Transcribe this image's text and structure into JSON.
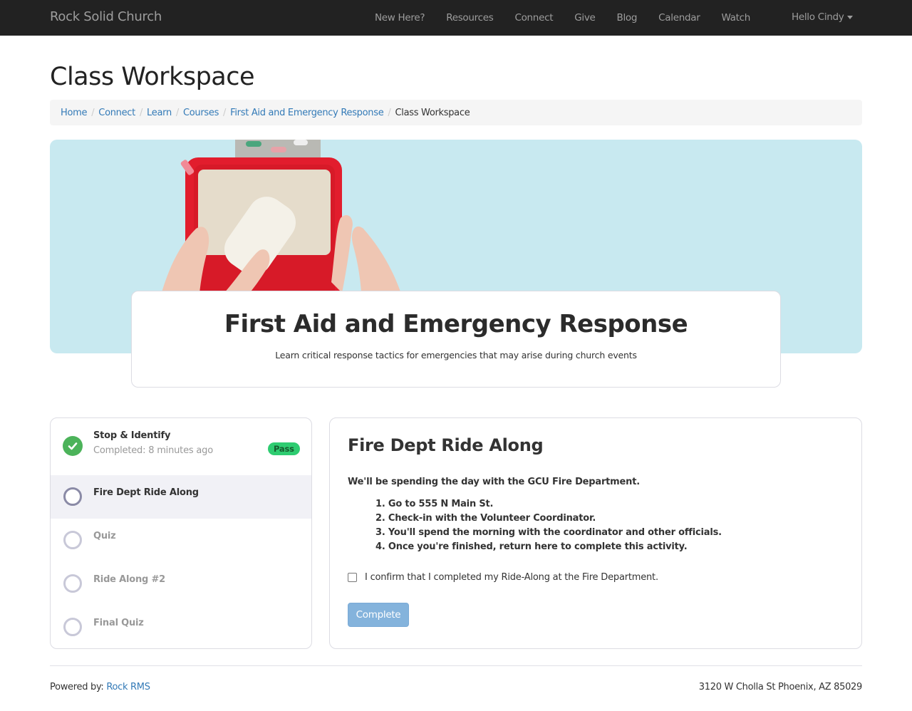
{
  "navbar": {
    "brand": "Rock Solid Church",
    "links": [
      "New Here?",
      "Resources",
      "Connect",
      "Give",
      "Blog",
      "Calendar",
      "Watch"
    ],
    "user_menu": "Hello Cindy"
  },
  "page": {
    "title": "Class Workspace"
  },
  "breadcrumb": {
    "items": [
      "Home",
      "Connect",
      "Learn",
      "Courses",
      "First Aid and Emergency Response"
    ],
    "active": "Class Workspace"
  },
  "course": {
    "title": "First Aid and Emergency Response",
    "description": "Learn critical response tactics for emergencies that may arise during church events",
    "hero_image": "first-aid-kit-photo"
  },
  "activities": [
    {
      "title": "Stop & Identify",
      "subtitle": "Completed: 8 minutes ago",
      "status": "completed",
      "badge": "Pass",
      "icon": "check-circle-icon"
    },
    {
      "title": "Fire Dept Ride Along",
      "status": "current",
      "icon": "circle-outline-icon"
    },
    {
      "title": "Quiz",
      "status": "locked",
      "icon": "circle-outline-icon"
    },
    {
      "title": "Ride Along #2",
      "status": "locked",
      "icon": "circle-outline-icon"
    },
    {
      "title": "Final Quiz",
      "status": "locked",
      "icon": "circle-outline-icon"
    }
  ],
  "activity_panel": {
    "title": "Fire Dept Ride Along",
    "intro": "We'll be spending the day with the GCU Fire Department.",
    "steps": [
      "1. Go to 555 N Main St.",
      "2. Check-in with the Volunteer Coordinator.",
      "3. You'll spend the morning with the coordinator and other officials.",
      "4. Once you're finished, return here to complete this activity."
    ],
    "confirm_label": "I confirm that I completed my Ride-Along at the Fire Department.",
    "confirm_checked": false,
    "complete_button": "Complete",
    "complete_enabled": false
  },
  "footer": {
    "powered_by_label": "Powered by: ",
    "powered_by_link": "Rock RMS",
    "address": "3120 W Cholla St Phoenix, AZ 85029"
  },
  "colors": {
    "navbar_bg": "#222222",
    "link": "#337ab7",
    "hero_bg": "#c8e9f0",
    "success": "#4cb35a",
    "pass_badge": "#2ecc71",
    "button_disabled": "#84b3dc"
  }
}
